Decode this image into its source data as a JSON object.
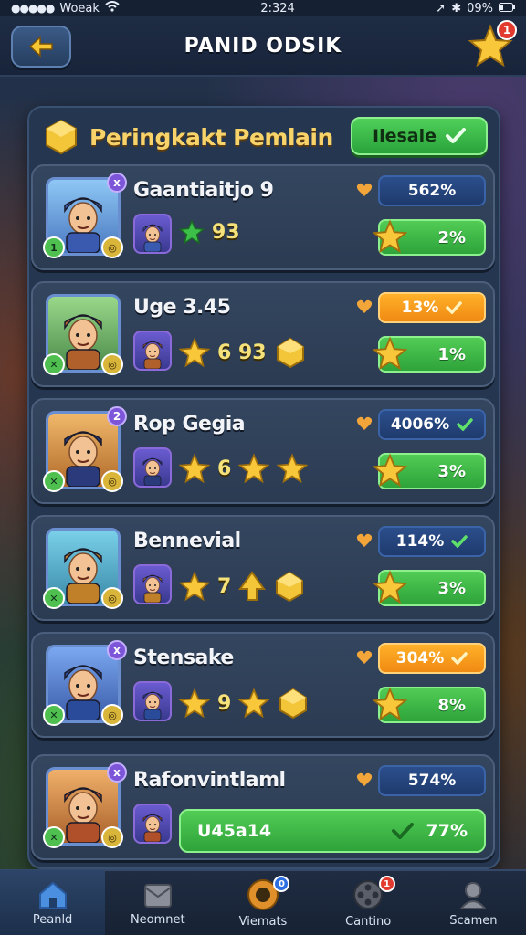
{
  "status_bar": {
    "carrier": "Woeak",
    "time": "2:324",
    "battery": "09%"
  },
  "header": {
    "title": "PANID ODSIK",
    "notification_count": "1"
  },
  "panel": {
    "title": "Peringkakt Pemlain",
    "action_label": "Ilesale"
  },
  "players": [
    {
      "rank": "x",
      "name": "Gaantiaitjo 9",
      "stat_value": "93",
      "percent": "562%",
      "score": "2%",
      "badge_left": "1",
      "badge_right": ""
    },
    {
      "rank": "",
      "name": "Uge 3.45",
      "stat_value": "6 93",
      "percent": "13%",
      "score": "1%",
      "badge_left": "",
      "badge_right": ""
    },
    {
      "rank": "2",
      "name": "Rop Gegia",
      "stat_value": "6",
      "percent": "4006%",
      "score": "3%",
      "badge_left": "",
      "badge_right": ""
    },
    {
      "rank": "",
      "name": "Bennevial",
      "stat_value": "7",
      "percent": "114%",
      "score": "3%",
      "badge_left": "",
      "badge_right": ""
    },
    {
      "rank": "x",
      "name": "Stensake",
      "stat_value": "9",
      "percent": "304%",
      "score": "8%",
      "badge_left": "",
      "badge_right": ""
    },
    {
      "rank": "x",
      "name": "Rafonvintlaml",
      "bar_label": "U45a14",
      "percent": "574%",
      "score": "77%"
    }
  ],
  "nav": [
    {
      "label": "Peanld",
      "icon": "home-icon"
    },
    {
      "label": "Neomnet",
      "icon": "mail-icon"
    },
    {
      "label": "Viemats",
      "icon": "event-icon",
      "badge": "0"
    },
    {
      "label": "Cantino",
      "icon": "film-icon",
      "badge": "1"
    },
    {
      "label": "Scamen",
      "icon": "profile-icon"
    }
  ],
  "colors": {
    "gold": "#f7d36a",
    "green": "#3cbf48",
    "blue_pill": "#2b4e8c",
    "orange_pill": "#f79a1a",
    "panel": "#243650"
  }
}
